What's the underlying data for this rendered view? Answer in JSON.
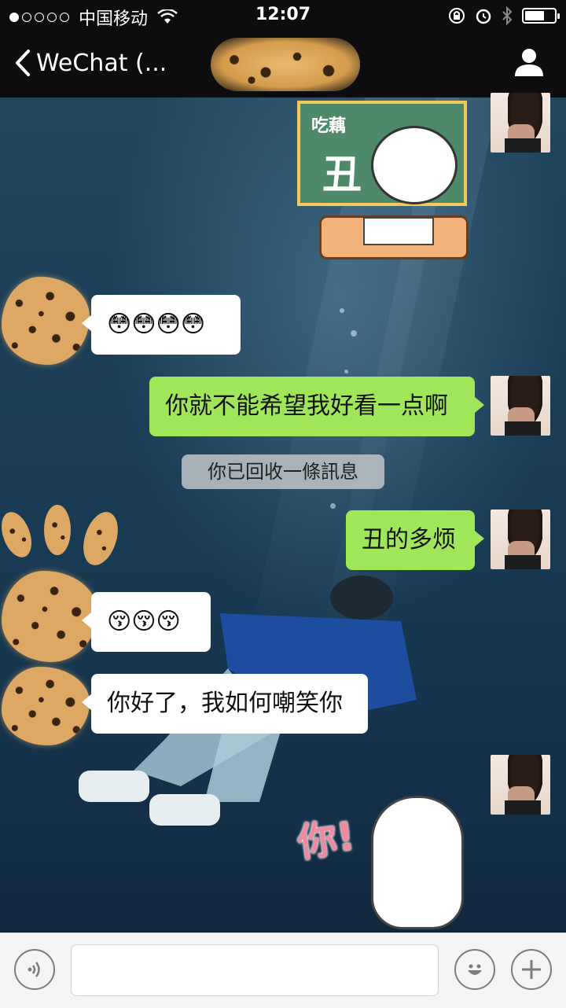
{
  "status_bar": {
    "carrier": "中国移动",
    "time": "12:07",
    "signal_dots_filled": 1,
    "signal_dots_total": 5
  },
  "nav": {
    "back_label": "WeChat (...",
    "back_icon": "chevron-left-icon",
    "profile_icon": "person-icon"
  },
  "messages": {
    "m1_emojis": "😳😳😳😳",
    "m2_text": "你就不能希望我好看一点啊",
    "system_note": "你已回收一條訊息",
    "m3_text": "丑的多烦",
    "m4_emojis": "😚😚😚",
    "m5_text": "你好了，我如何嘲笑你"
  },
  "stickers": {
    "board_line1": "吃藕",
    "board_line2": "丑",
    "you_text": "你!"
  },
  "input": {
    "placeholder": "",
    "voice_icon": "voice-icon",
    "emoji_icon": "emoji-icon",
    "plus_icon": "plus-icon"
  },
  "colors": {
    "outgoing_bubble": "#9fe658",
    "incoming_bubble": "#ffffff",
    "bar_background": "#0d0d0f"
  }
}
